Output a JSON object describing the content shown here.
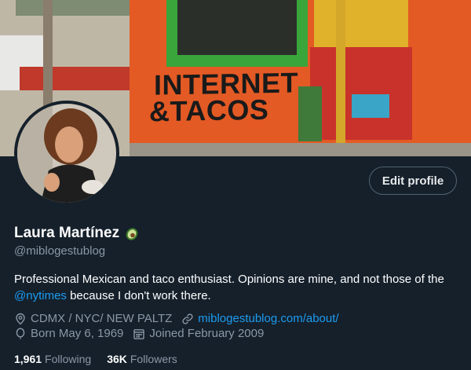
{
  "banner": {
    "sign_line1": "INTERNET",
    "sign_line2": "&TACOS"
  },
  "profile": {
    "edit_label": "Edit profile",
    "name": "Laura Martínez",
    "name_emoji": "avocado-icon",
    "handle": "@miblogestublog",
    "bio_before": "Professional Mexican and taco enthusiast. Opinions are mine, and not those of the ",
    "bio_mention": "@nytimes",
    "bio_after": " because I don't work there.",
    "location": "CDMX / NYC/ NEW PALTZ",
    "website": "miblogestublog.com/about/",
    "birthday": "Born May 6, 1969",
    "joined": "Joined February 2009",
    "following_count": "1,961",
    "following_label": "Following",
    "followers_count": "36K",
    "followers_label": "Followers"
  },
  "colors": {
    "background": "#15202b",
    "accent": "#1d9bf0",
    "muted": "#8b98a5"
  }
}
